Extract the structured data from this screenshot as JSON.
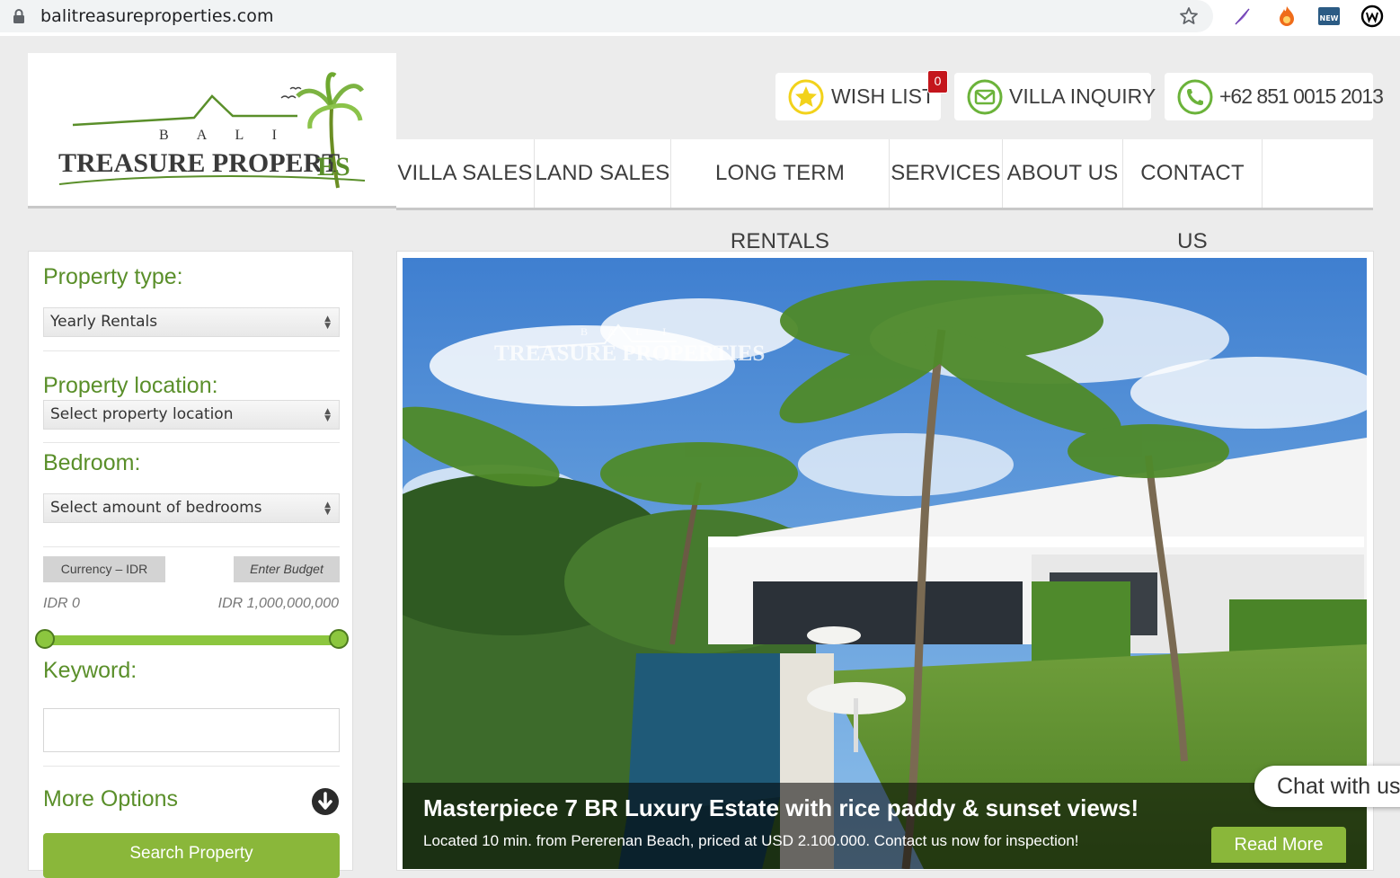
{
  "browser": {
    "url": "balitreasureproperties.com",
    "extension_new_label": "NEW"
  },
  "logo": {
    "line1": "B A L I",
    "line2": "TREASURE PROPERT",
    "line2_end": "ES"
  },
  "top_buttons": {
    "wishlist": "WISH LIST",
    "wishlist_count": "0",
    "inquiry": "VILLA INQUIRY",
    "phone": "+62 851 0015 2013"
  },
  "nav": {
    "items": [
      "VILLA SALES",
      "LAND SALES",
      "LONG TERM RENTALS",
      "SERVICES",
      "ABOUT US",
      "CONTACT US"
    ]
  },
  "sidebar": {
    "property_type_label": "Property type:",
    "property_type_value": "Yearly Rentals",
    "location_label": "Property location:",
    "location_value": "Select property location",
    "bedroom_label": "Bedroom:",
    "bedroom_value": "Select amount of bedrooms",
    "currency_button": "Currency –  IDR",
    "budget_button": "Enter Budget",
    "range_min": "IDR 0",
    "range_max": "IDR 1,000,000,000",
    "keyword_label": "Keyword:",
    "keyword_value": "",
    "more_options": "More Options",
    "search_button": "Search Property"
  },
  "hero": {
    "title": "Masterpiece 7 BR Luxury Estate with rice paddy & sunset views!",
    "subtitle": "Located 10 min. from Pererenan Beach, priced at USD 2.100.000. Contact us now for inspection!",
    "read_more": "Read More",
    "watermark_line1": "B A L I",
    "watermark_line2": "TREASURE PROPERTIES"
  },
  "chat": {
    "label": "Chat with us"
  },
  "colors": {
    "brand_green": "#5a8f2a",
    "accent_green": "#8ab73a",
    "badge_red": "#c4161c"
  }
}
